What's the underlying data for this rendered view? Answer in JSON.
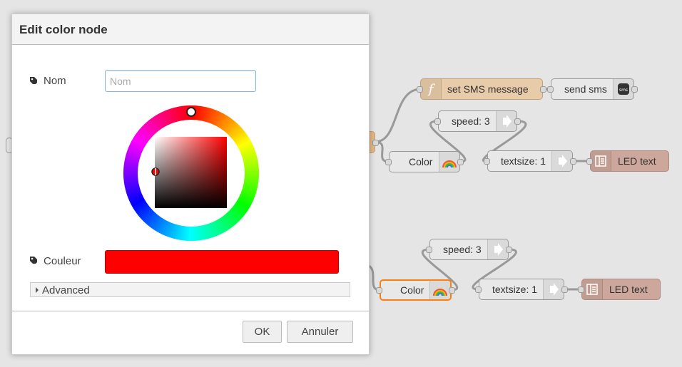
{
  "dialog": {
    "title": "Edit color node",
    "name_label": "Nom",
    "name_placeholder": "Nom",
    "name_value": "",
    "color_label": "Couleur",
    "color_value": "#ff0000",
    "advanced_label": "Advanced",
    "ok_label": "OK",
    "cancel_label": "Annuler"
  },
  "flow": {
    "nodes": [
      {
        "label": "set SMS message",
        "icon": "function-icon",
        "type": "function"
      },
      {
        "label": "send sms",
        "icon": "sms-icon",
        "type": "output"
      },
      {
        "label": "speed: 3",
        "icon": "arrow-right-icon",
        "type": "change"
      },
      {
        "label": "Color",
        "icon": "rainbow-icon",
        "type": "color"
      },
      {
        "label": "textsize: 1",
        "icon": "arrow-right-icon",
        "type": "change"
      },
      {
        "label": "LED text",
        "icon": "led-display-icon",
        "type": "led"
      },
      {
        "label": "speed: 3",
        "icon": "arrow-right-icon",
        "type": "change"
      },
      {
        "label": "Color",
        "icon": "rainbow-icon",
        "type": "color"
      },
      {
        "label": "textsize: 1",
        "icon": "arrow-right-icon",
        "type": "change"
      },
      {
        "label": "LED text",
        "icon": "led-display-icon",
        "type": "led"
      }
    ]
  }
}
